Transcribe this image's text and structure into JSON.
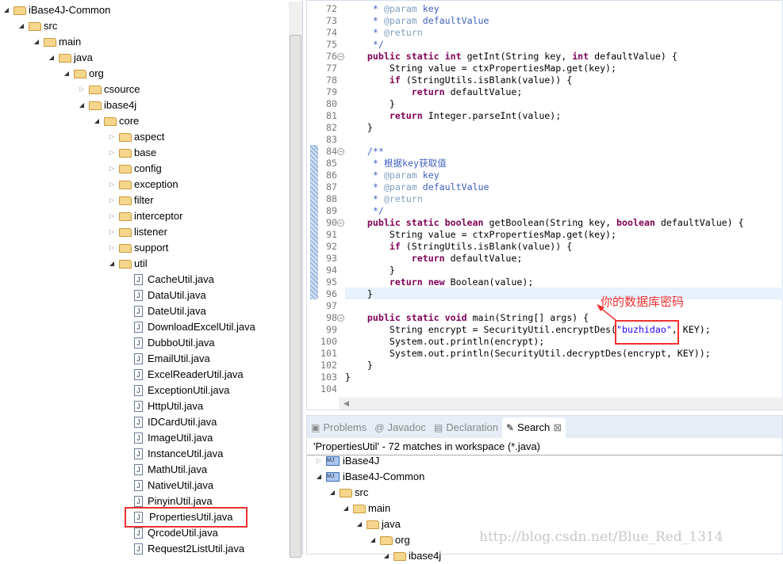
{
  "project_tree": {
    "items": [
      {
        "label": "iBase4J-Common",
        "level": 0,
        "expanded": true,
        "kind": "folder"
      },
      {
        "label": "src",
        "level": 1,
        "expanded": true,
        "kind": "folder"
      },
      {
        "label": "main",
        "level": 2,
        "expanded": true,
        "kind": "folder"
      },
      {
        "label": "java",
        "level": 3,
        "expanded": true,
        "kind": "folder"
      },
      {
        "label": "org",
        "level": 4,
        "expanded": true,
        "kind": "folder"
      },
      {
        "label": "csource",
        "level": 5,
        "expanded": false,
        "kind": "folder"
      },
      {
        "label": "ibase4j",
        "level": 5,
        "expanded": true,
        "kind": "folder"
      },
      {
        "label": "core",
        "level": 6,
        "expanded": true,
        "kind": "folder"
      },
      {
        "label": "aspect",
        "level": 7,
        "expanded": false,
        "kind": "folder"
      },
      {
        "label": "base",
        "level": 7,
        "expanded": false,
        "kind": "folder"
      },
      {
        "label": "config",
        "level": 7,
        "expanded": false,
        "kind": "folder"
      },
      {
        "label": "exception",
        "level": 7,
        "expanded": false,
        "kind": "folder"
      },
      {
        "label": "filter",
        "level": 7,
        "expanded": false,
        "kind": "folder"
      },
      {
        "label": "interceptor",
        "level": 7,
        "expanded": false,
        "kind": "folder"
      },
      {
        "label": "listener",
        "level": 7,
        "expanded": false,
        "kind": "folder"
      },
      {
        "label": "support",
        "level": 7,
        "expanded": false,
        "kind": "folder"
      },
      {
        "label": "util",
        "level": 7,
        "expanded": true,
        "kind": "folder"
      },
      {
        "label": "CacheUtil.java",
        "level": 8,
        "kind": "file"
      },
      {
        "label": "DataUtil.java",
        "level": 8,
        "kind": "file"
      },
      {
        "label": "DateUtil.java",
        "level": 8,
        "kind": "file"
      },
      {
        "label": "DownloadExcelUtil.java",
        "level": 8,
        "kind": "file"
      },
      {
        "label": "DubboUtil.java",
        "level": 8,
        "kind": "file"
      },
      {
        "label": "EmailUtil.java",
        "level": 8,
        "kind": "file"
      },
      {
        "label": "ExcelReaderUtil.java",
        "level": 8,
        "kind": "file"
      },
      {
        "label": "ExceptionUtil.java",
        "level": 8,
        "kind": "file"
      },
      {
        "label": "HttpUtil.java",
        "level": 8,
        "kind": "file"
      },
      {
        "label": "IDCardUtil.java",
        "level": 8,
        "kind": "file"
      },
      {
        "label": "ImageUtil.java",
        "level": 8,
        "kind": "file"
      },
      {
        "label": "InstanceUtil.java",
        "level": 8,
        "kind": "file"
      },
      {
        "label": "MathUtil.java",
        "level": 8,
        "kind": "file"
      },
      {
        "label": "NativeUtil.java",
        "level": 8,
        "kind": "file"
      },
      {
        "label": "PinyinUtil.java",
        "level": 8,
        "kind": "file"
      },
      {
        "label": "PropertiesUtil.java",
        "level": 8,
        "kind": "file",
        "highlighted": true
      },
      {
        "label": "QrcodeUtil.java",
        "level": 8,
        "kind": "file"
      },
      {
        "label": "Request2ListUtil.java",
        "level": 8,
        "kind": "file"
      }
    ]
  },
  "editor": {
    "lines": [
      {
        "n": "72",
        "t": [
          [
            "",
            "     "
          ],
          [
            "cm",
            "* "
          ],
          [
            "tag",
            "@param"
          ],
          [
            "cm",
            " key"
          ]
        ]
      },
      {
        "n": "73",
        "t": [
          [
            "",
            "     "
          ],
          [
            "cm",
            "* "
          ],
          [
            "tag",
            "@param"
          ],
          [
            "cm",
            " defaultValue"
          ]
        ]
      },
      {
        "n": "74",
        "t": [
          [
            "",
            "     "
          ],
          [
            "cm",
            "* "
          ],
          [
            "tag",
            "@return"
          ]
        ]
      },
      {
        "n": "75",
        "t": [
          [
            "",
            "     "
          ],
          [
            "cm",
            "*/"
          ]
        ]
      },
      {
        "n": "76",
        "fold": true,
        "t": [
          [
            "",
            "    "
          ],
          [
            "kw",
            "public static int"
          ],
          [
            "",
            " getInt(String key, "
          ],
          [
            "kw",
            "int"
          ],
          [
            "",
            " defaultValue) {"
          ]
        ]
      },
      {
        "n": "77",
        "t": [
          [
            "",
            "        String value = ctxPropertiesMap.get(key);"
          ]
        ]
      },
      {
        "n": "78",
        "t": [
          [
            "",
            "        "
          ],
          [
            "kw",
            "if"
          ],
          [
            "",
            " (StringUtils.isBlank(value)) {"
          ]
        ]
      },
      {
        "n": "79",
        "t": [
          [
            "",
            "            "
          ],
          [
            "kw",
            "return"
          ],
          [
            "",
            " defaultValue;"
          ]
        ]
      },
      {
        "n": "80",
        "t": [
          [
            "",
            "        }"
          ]
        ]
      },
      {
        "n": "81",
        "t": [
          [
            "",
            "        "
          ],
          [
            "kw",
            "return"
          ],
          [
            "",
            " Integer.parseInt(value);"
          ]
        ]
      },
      {
        "n": "82",
        "t": [
          [
            "",
            "    }"
          ]
        ]
      },
      {
        "n": "83",
        "t": []
      },
      {
        "n": "84",
        "fold": true,
        "t": [
          [
            "",
            "    "
          ],
          [
            "cm",
            "/**"
          ]
        ]
      },
      {
        "n": "85",
        "t": [
          [
            "",
            "     "
          ],
          [
            "cm",
            "* 根据key获取值"
          ]
        ]
      },
      {
        "n": "86",
        "t": [
          [
            "",
            "     "
          ],
          [
            "cm",
            "* "
          ],
          [
            "tag",
            "@param"
          ],
          [
            "cm",
            " key"
          ]
        ]
      },
      {
        "n": "87",
        "t": [
          [
            "",
            "     "
          ],
          [
            "cm",
            "* "
          ],
          [
            "tag",
            "@param"
          ],
          [
            "cm",
            " defaultValue"
          ]
        ]
      },
      {
        "n": "88",
        "t": [
          [
            "",
            "     "
          ],
          [
            "cm",
            "* "
          ],
          [
            "tag",
            "@return"
          ]
        ]
      },
      {
        "n": "89",
        "t": [
          [
            "",
            "     "
          ],
          [
            "cm",
            "*/"
          ]
        ]
      },
      {
        "n": "90",
        "fold": true,
        "t": [
          [
            "",
            "    "
          ],
          [
            "kw",
            "public static boolean"
          ],
          [
            "",
            " getBoolean(String key, "
          ],
          [
            "kw",
            "boolean"
          ],
          [
            "",
            " defaultValue) {"
          ]
        ]
      },
      {
        "n": "91",
        "t": [
          [
            "",
            "        String value = ctxPropertiesMap.get(key);"
          ]
        ]
      },
      {
        "n": "92",
        "t": [
          [
            "",
            "        "
          ],
          [
            "kw",
            "if"
          ],
          [
            "",
            " (StringUtils.isBlank(value)) {"
          ]
        ]
      },
      {
        "n": "93",
        "t": [
          [
            "",
            "            "
          ],
          [
            "kw",
            "return"
          ],
          [
            "",
            " defaultValue;"
          ]
        ]
      },
      {
        "n": "94",
        "t": [
          [
            "",
            "        }"
          ]
        ]
      },
      {
        "n": "95",
        "t": [
          [
            "",
            "        "
          ],
          [
            "kw",
            "return new"
          ],
          [
            "",
            " Boolean(value);"
          ]
        ]
      },
      {
        "n": "96",
        "t": [
          [
            "",
            "    }"
          ]
        ]
      },
      {
        "n": "97",
        "t": []
      },
      {
        "n": "98",
        "fold": true,
        "t": [
          [
            "",
            "    "
          ],
          [
            "kw",
            "public static void"
          ],
          [
            "",
            " main(String[] args) {"
          ]
        ]
      },
      {
        "n": "99",
        "t": [
          [
            "",
            "        String encrypt = SecurityUtil.encryptDes("
          ],
          [
            "st",
            "\"buzhidao\""
          ],
          [
            "",
            ", KEY);"
          ]
        ]
      },
      {
        "n": "100",
        "t": [
          [
            "",
            "        System.out.println(encrypt);"
          ]
        ]
      },
      {
        "n": "101",
        "t": [
          [
            "",
            "        System.out.println(SecurityUtil.decryptDes(encrypt, KEY));"
          ]
        ]
      },
      {
        "n": "102",
        "t": [
          [
            "",
            "    }"
          ]
        ]
      },
      {
        "n": "103",
        "t": [
          [
            "",
            "}"
          ]
        ]
      },
      {
        "n": "104",
        "t": []
      }
    ]
  },
  "annotation": {
    "note": "你的数据库密码",
    "color": "#f03030"
  },
  "bottom_panel": {
    "tabs": [
      {
        "label": "Problems",
        "icon": "problems-icon"
      },
      {
        "label": "Javadoc",
        "icon": "at-icon"
      },
      {
        "label": "Declaration",
        "icon": "declaration-icon"
      },
      {
        "label": "Search",
        "icon": "search-icon",
        "active": true
      }
    ],
    "status": "'PropertiesUtil' - 72 matches in workspace (*.java)",
    "results": [
      {
        "label": "iBase4J",
        "level": 0,
        "expanded": false,
        "kind": "project"
      },
      {
        "label": "iBase4J-Common",
        "level": 0,
        "expanded": true,
        "kind": "project"
      },
      {
        "label": "src",
        "level": 1,
        "expanded": true,
        "kind": "folder"
      },
      {
        "label": "main",
        "level": 2,
        "expanded": true,
        "kind": "folder"
      },
      {
        "label": "java",
        "level": 3,
        "expanded": true,
        "kind": "folder"
      },
      {
        "label": "org",
        "level": 4,
        "expanded": true,
        "kind": "folder"
      },
      {
        "label": "ibase4j",
        "level": 5,
        "expanded": true,
        "kind": "folder"
      }
    ]
  },
  "watermark": "http://blog.csdn.net/Blue_Red_1314"
}
